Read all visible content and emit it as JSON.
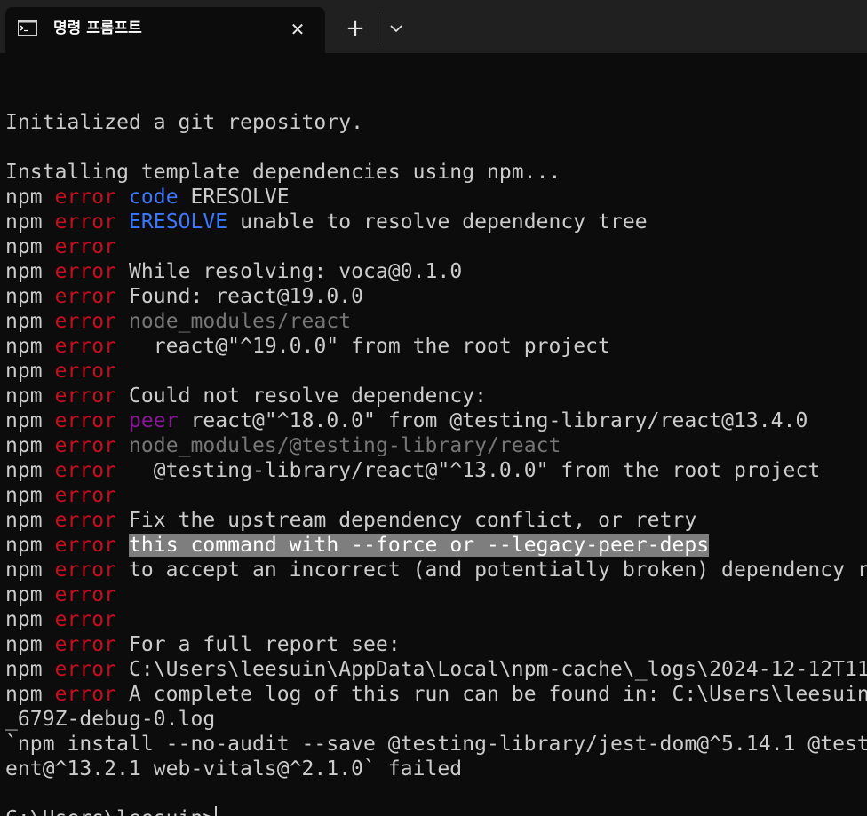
{
  "window": {
    "tab_title": "명령 프롬프트",
    "tab_icon": "terminal-icon",
    "close_symbol": "✕",
    "new_tab_symbol": "+"
  },
  "colors": {
    "background": "#0c0c0c",
    "titlebar": "#202020",
    "text": "#cccccc",
    "error_red": "#c50f1f",
    "keyword_blue": "#3b78ff",
    "peer_purple": "#881798",
    "dim_gray": "#767676",
    "selection": "#7e7e7e"
  },
  "terminal": {
    "lines": [
      [
        {
          "t": ""
        }
      ],
      [
        {
          "t": "Initialized a git repository."
        }
      ],
      [
        {
          "t": ""
        }
      ],
      [
        {
          "t": "Installing template dependencies using npm..."
        }
      ],
      [
        {
          "t": "npm "
        },
        {
          "t": "error",
          "c": "red"
        },
        {
          "t": " "
        },
        {
          "t": "code",
          "c": "blue"
        },
        {
          "t": " ERESOLVE"
        }
      ],
      [
        {
          "t": "npm "
        },
        {
          "t": "error",
          "c": "red"
        },
        {
          "t": " "
        },
        {
          "t": "ERESOLVE",
          "c": "blue"
        },
        {
          "t": " unable to resolve dependency tree"
        }
      ],
      [
        {
          "t": "npm "
        },
        {
          "t": "error",
          "c": "red"
        }
      ],
      [
        {
          "t": "npm "
        },
        {
          "t": "error",
          "c": "red"
        },
        {
          "t": " While resolving: voca@0.1.0"
        }
      ],
      [
        {
          "t": "npm "
        },
        {
          "t": "error",
          "c": "red"
        },
        {
          "t": " Found: react@19.0.0"
        }
      ],
      [
        {
          "t": "npm "
        },
        {
          "t": "error",
          "c": "red"
        },
        {
          "t": " "
        },
        {
          "t": "node_modules/react",
          "c": "gray"
        }
      ],
      [
        {
          "t": "npm "
        },
        {
          "t": "error",
          "c": "red"
        },
        {
          "t": "   react@\"^19.0.0\" from the root project"
        }
      ],
      [
        {
          "t": "npm "
        },
        {
          "t": "error",
          "c": "red"
        }
      ],
      [
        {
          "t": "npm "
        },
        {
          "t": "error",
          "c": "red"
        },
        {
          "t": " Could not resolve dependency:"
        }
      ],
      [
        {
          "t": "npm "
        },
        {
          "t": "error",
          "c": "red"
        },
        {
          "t": " "
        },
        {
          "t": "peer",
          "c": "purple"
        },
        {
          "t": " react@\"^18.0.0\" from @testing-library/react@13.4.0"
        }
      ],
      [
        {
          "t": "npm "
        },
        {
          "t": "error",
          "c": "red"
        },
        {
          "t": " "
        },
        {
          "t": "node_modules/@testing-library/react",
          "c": "gray"
        }
      ],
      [
        {
          "t": "npm "
        },
        {
          "t": "error",
          "c": "red"
        },
        {
          "t": "   @testing-library/react@\"^13.0.0\" from the root project"
        }
      ],
      [
        {
          "t": "npm "
        },
        {
          "t": "error",
          "c": "red"
        }
      ],
      [
        {
          "t": "npm "
        },
        {
          "t": "error",
          "c": "red"
        },
        {
          "t": " Fix the upstream dependency conflict, or retry"
        }
      ],
      [
        {
          "t": "npm "
        },
        {
          "t": "error",
          "c": "red"
        },
        {
          "t": " "
        },
        {
          "t": "this command with --force or --legacy-peer-deps",
          "c": "sel"
        }
      ],
      [
        {
          "t": "npm "
        },
        {
          "t": "error",
          "c": "red"
        },
        {
          "t": " to accept an incorrect (and potentially broken) dependency r"
        }
      ],
      [
        {
          "t": "npm "
        },
        {
          "t": "error",
          "c": "red"
        }
      ],
      [
        {
          "t": "npm "
        },
        {
          "t": "error",
          "c": "red"
        }
      ],
      [
        {
          "t": "npm "
        },
        {
          "t": "error",
          "c": "red"
        },
        {
          "t": " For a full report see:"
        }
      ],
      [
        {
          "t": "npm "
        },
        {
          "t": "error",
          "c": "red"
        },
        {
          "t": " C:\\Users\\leesuin\\AppData\\Local\\npm-cache\\_logs\\2024-12-12T11"
        }
      ],
      [
        {
          "t": "npm "
        },
        {
          "t": "error",
          "c": "red"
        },
        {
          "t": " A complete log of this run can be found in: C:\\Users\\leesuin"
        }
      ],
      [
        {
          "t": "_679Z-debug-0.log"
        }
      ],
      [
        {
          "t": "`npm install --no-audit --save @testing-library/jest-dom@^5.14.1 @test"
        }
      ],
      [
        {
          "t": "ent@^13.2.1 web-vitals@^2.1.0` failed"
        }
      ],
      [
        {
          "t": ""
        }
      ],
      [
        {
          "t": "C:\\Users\\leesuin>"
        }
      ]
    ]
  }
}
